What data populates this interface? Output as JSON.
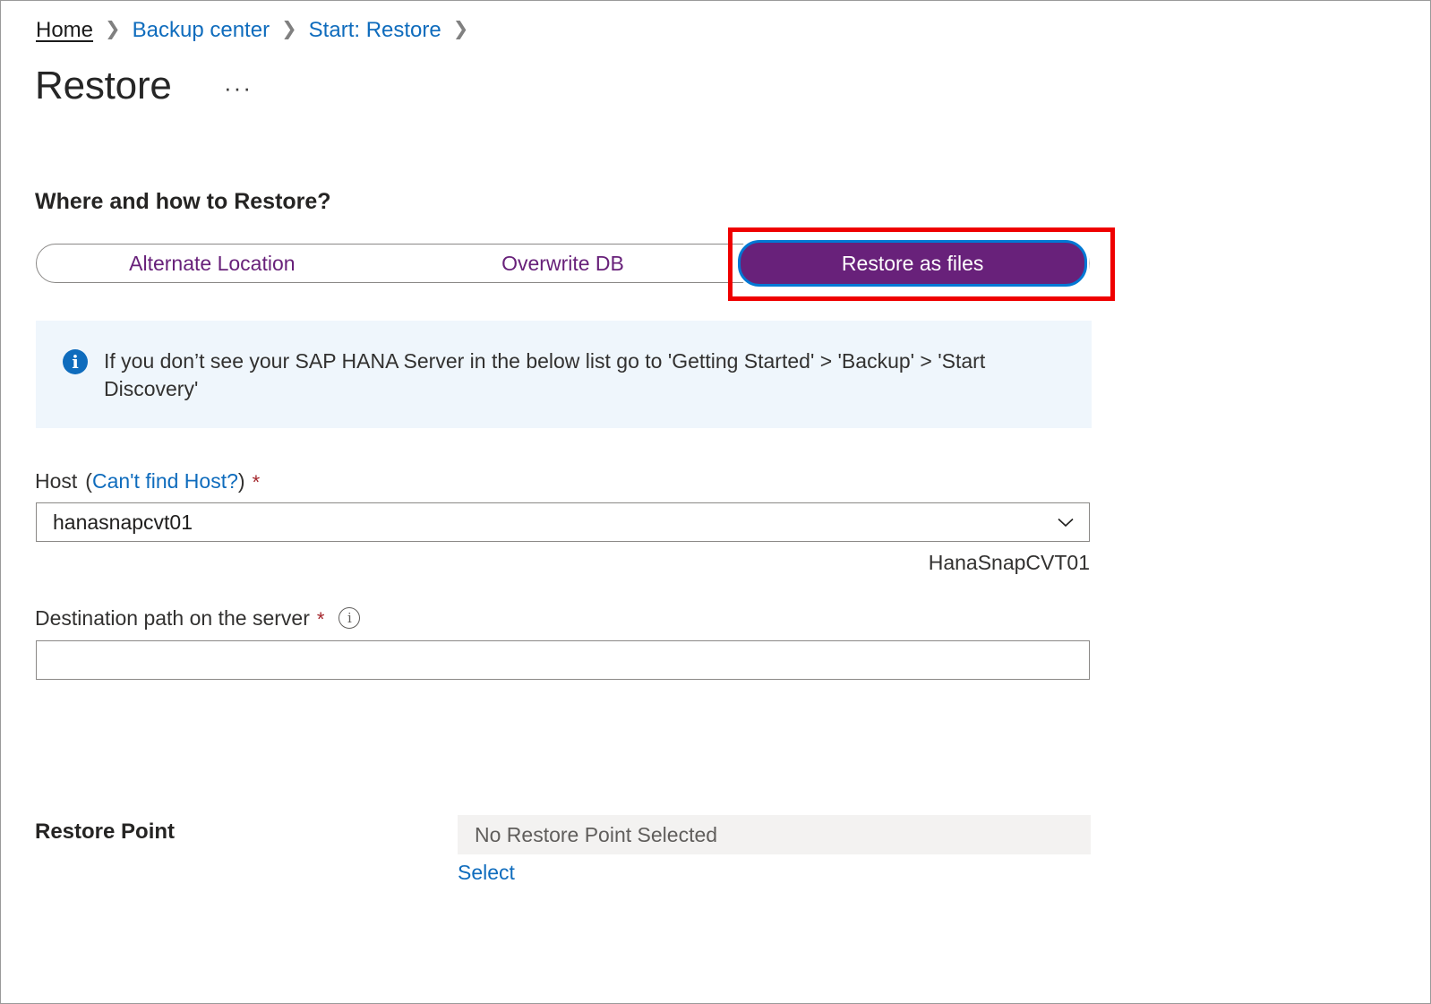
{
  "breadcrumb": {
    "separator": "❯",
    "items": [
      {
        "label": "Home"
      },
      {
        "label": "Backup center"
      },
      {
        "label": "Start: Restore"
      }
    ]
  },
  "header": {
    "title": "Restore",
    "more_menu": "···"
  },
  "section": {
    "heading": "Where and how to Restore?"
  },
  "tabs": [
    {
      "label": "Alternate Location",
      "selected": false
    },
    {
      "label": "Overwrite DB",
      "selected": false
    },
    {
      "label": "Restore as files",
      "selected": true
    }
  ],
  "info_banner": {
    "icon": "info-icon",
    "text": "If you don’t see your SAP HANA Server in the below list go to 'Getting Started' > 'Backup' > 'Start Discovery'"
  },
  "host_field": {
    "label": "Host",
    "label_open_paren": "(",
    "label_link": "Can't find Host?",
    "label_close_paren": ")",
    "required_marker": "*",
    "value": "hanasnapcvt01",
    "placeholder": "",
    "chevron": "chevron-down-icon",
    "helper_text": "HanaSnapCVT01"
  },
  "destination_field": {
    "label": "Destination path on the server",
    "required_marker": "*",
    "tooltip": "i",
    "value": "",
    "placeholder": ""
  },
  "restore_point": {
    "label": "Restore Point",
    "value": "No Restore Point Selected",
    "select_link": "Select"
  },
  "colors": {
    "accent_purple": "#68217A",
    "link_blue": "#0F6CBD",
    "focus_blue": "#0078D4",
    "highlight_red": "#EF0000",
    "required_red": "#A4262C",
    "info_bg": "#EFF6FC",
    "disabled_bg": "#F3F2F1"
  }
}
